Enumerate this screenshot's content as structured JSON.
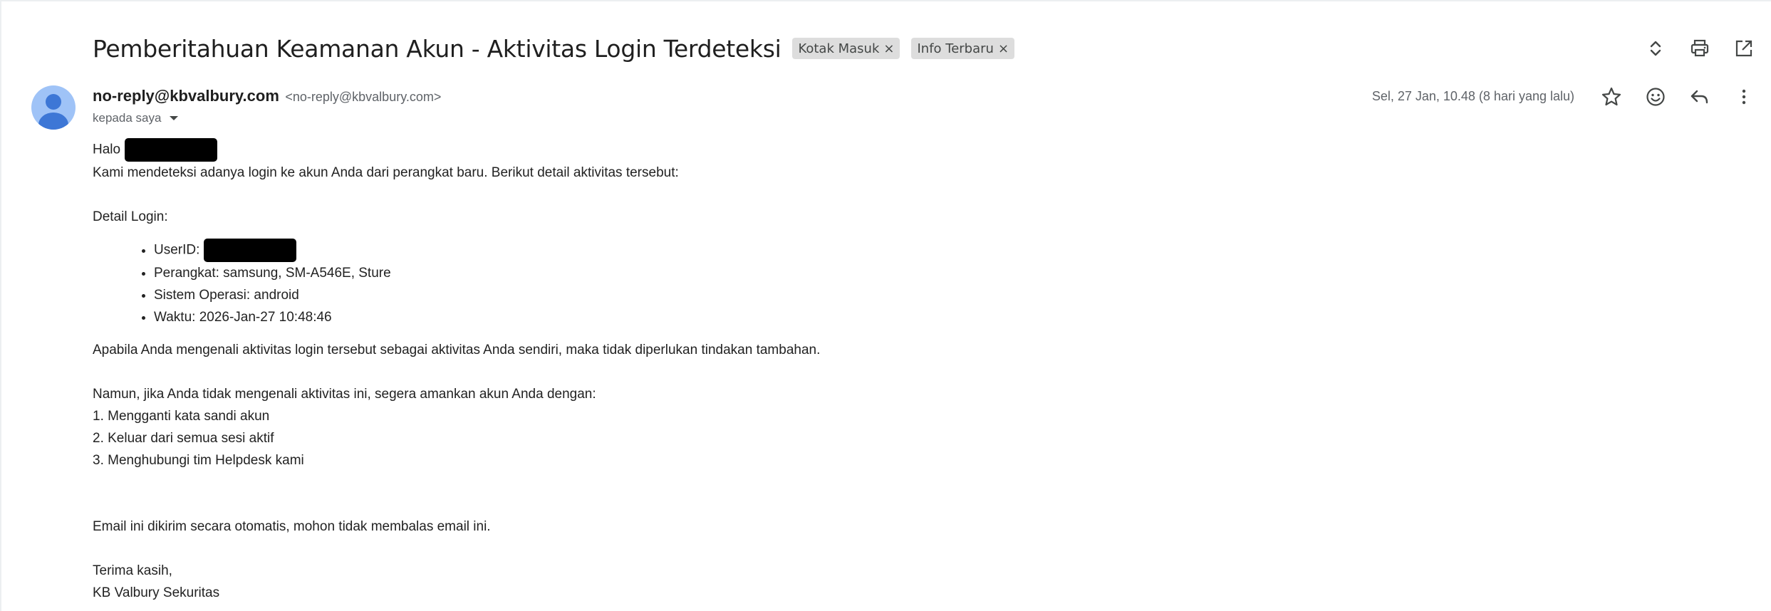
{
  "email": {
    "subject": "Pemberitahuan Keamanan Akun - Aktivitas Login Terdeteksi",
    "labels": [
      {
        "name": "Kotak Masuk",
        "remove": "×"
      },
      {
        "name": "Info Terbaru",
        "remove": "×"
      }
    ],
    "sender": {
      "name": "no-reply@kbvalbury.com",
      "email": "<no-reply@kbvalbury.com>"
    },
    "recipient": "kepada saya",
    "date": "Sel, 27 Jan, 10.48 (8 hari yang lalu)",
    "body": {
      "greeting": "Halo",
      "intro": "Kami mendeteksi adanya login ke akun Anda dari perangkat baru. Berikut detail aktivitas tersebut:",
      "details_heading": "Detail Login:",
      "details": {
        "userid": "UserID:",
        "device": "Perangkat: samsung, SM-A546E, Sture",
        "os": "Sistem Operasi: android",
        "time": "Waktu: 2026-Jan-27 10:48:46"
      },
      "recognize": "Apabila Anda mengenali aktivitas login tersebut sebagai aktivitas Anda sendiri, maka tidak diperlukan tindakan tambahan.",
      "not_recognize": "Namun, jika Anda tidak mengenali aktivitas ini, segera amankan akun Anda dengan:",
      "steps": [
        "1. Mengganti kata sandi akun",
        "2. Keluar dari semua sesi aktif",
        "3. Menghubungi tim Helpdesk kami"
      ],
      "auto_notice": "Email ini dikirim secara otomatis, mohon tidak membalas email ini.",
      "closing": "Terima kasih,",
      "signature": "KB Valbury Sekuritas"
    }
  },
  "icons": {
    "toolbar": [
      "expand-collapse-icon",
      "print-icon",
      "open-in-new-window-icon"
    ],
    "message": [
      "star-icon",
      "emoji-icon",
      "reply-icon",
      "more-vert-icon"
    ]
  },
  "colors": {
    "avatar_bg": "#9fc3f7",
    "avatar_fg": "#3d77d6",
    "label_chip_bg": "#dddddd",
    "redaction": "#000000"
  }
}
